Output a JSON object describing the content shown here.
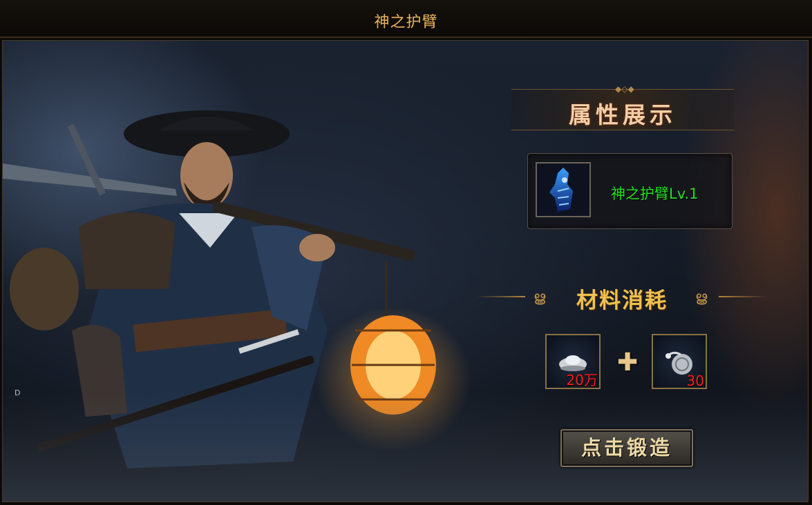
{
  "window": {
    "title": "神之护臂"
  },
  "attributes": {
    "header": "属性展示",
    "item": {
      "name": "神之护臂Lv.1",
      "icon": "blue-gauntlet-icon",
      "name_color": "#21e421"
    }
  },
  "materials": {
    "header": "材料消耗",
    "items": [
      {
        "icon": "silver-ingot-icon",
        "count": "20万"
      },
      {
        "icon": "silver-pouch-icon",
        "count": "30"
      }
    ],
    "plus_icon": "plus-icon"
  },
  "forge_button": {
    "label": "点击锻造"
  },
  "side_marker": "D",
  "colors": {
    "title": "#e9b35a",
    "count": "#ff1a1a",
    "accent": "#f0c050"
  }
}
